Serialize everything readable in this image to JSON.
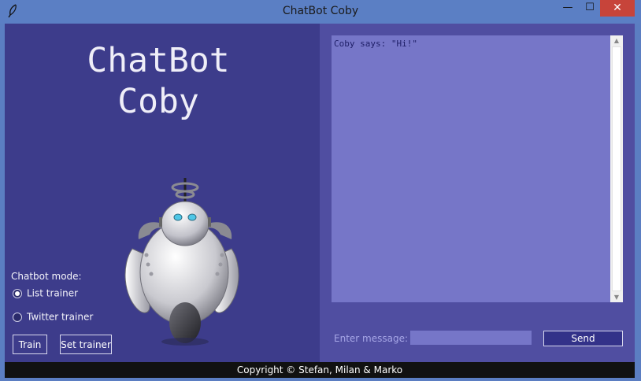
{
  "window": {
    "title": "ChatBot Coby",
    "minimize_glyph": "—",
    "maximize_glyph": "☐",
    "close_glyph": "✕"
  },
  "header": {
    "title_line1": "ChatBot",
    "title_line2": "Coby"
  },
  "mode": {
    "label": "Chatbot mode:",
    "options": [
      {
        "label": "List trainer",
        "selected": true
      },
      {
        "label": "Twitter trainer",
        "selected": false
      }
    ]
  },
  "buttons": {
    "train": "Train",
    "set_trainer": "Set trainer",
    "send": "Send"
  },
  "chat": {
    "messages": [
      "Coby says: \"Hi!\""
    ]
  },
  "input": {
    "label": "Enter message:",
    "value": ""
  },
  "footer": {
    "text": "Copyright © Stefan, Milan & Marko"
  },
  "colors": {
    "left_panel": "#3d3c8b",
    "right_panel": "#504ea1",
    "chat_area": "#7676c8",
    "send_button": "#333289",
    "titlebar": "#5b7fc4",
    "footer": "#111111"
  },
  "icons": {
    "app": "feather-icon",
    "mascot": "robot-illustration"
  }
}
